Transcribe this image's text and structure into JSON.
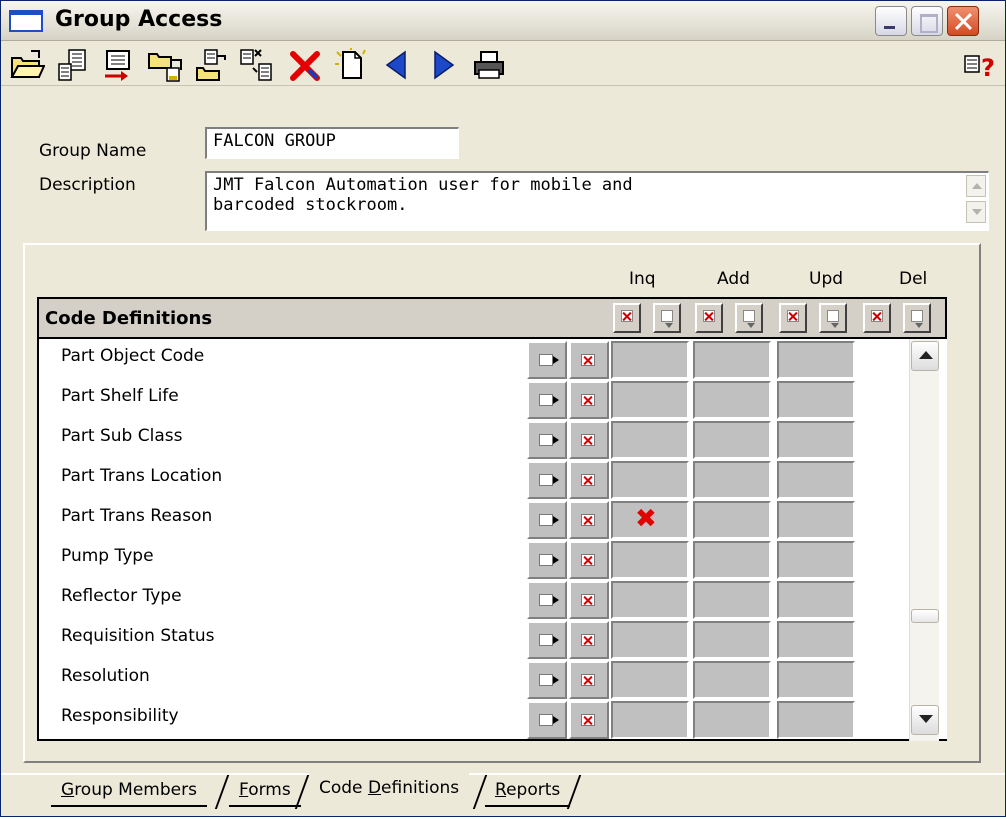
{
  "window": {
    "title": "Group Access"
  },
  "toolbar": {
    "tools": [
      "open-folder-icon",
      "copy-records-icon",
      "export-icon",
      "folder-move-icon",
      "paste-icon",
      "paste-special-icon",
      "delete-icon",
      "new-record-icon",
      "previous-icon",
      "next-icon",
      "print-icon",
      "help-icon"
    ]
  },
  "form": {
    "group_name_label": "Group Name",
    "group_name_value": "FALCON GROUP",
    "description_label": "Description",
    "description_line1": "JMT Falcon Automation user for mobile and",
    "description_line2": "barcoded stockroom."
  },
  "grid": {
    "section_title": "Code Definitions",
    "columns": {
      "inq": "Inq",
      "add": "Add",
      "upd": "Upd",
      "del": "Del"
    },
    "rows": [
      {
        "label": "Part Object Code",
        "inq": false
      },
      {
        "label": "Part Shelf Life",
        "inq": false
      },
      {
        "label": "Part Sub Class",
        "inq": false
      },
      {
        "label": "Part Trans Location",
        "inq": false
      },
      {
        "label": "Part Trans Reason",
        "inq": true
      },
      {
        "label": "Pump Type",
        "inq": false
      },
      {
        "label": "Reflector Type",
        "inq": false
      },
      {
        "label": "Requisition Status",
        "inq": false
      },
      {
        "label": "Resolution",
        "inq": false
      },
      {
        "label": "Responsibility",
        "inq": false
      }
    ],
    "selected_mark": "✖"
  },
  "tabs": [
    {
      "pre": "",
      "ul": "G",
      "post": "roup Members",
      "active": false
    },
    {
      "pre": "",
      "ul": "F",
      "post": "orms",
      "active": false
    },
    {
      "pre": "Code ",
      "ul": "D",
      "post": "efinitions",
      "active": true
    },
    {
      "pre": "",
      "ul": "R",
      "post": "eports",
      "active": false
    }
  ]
}
